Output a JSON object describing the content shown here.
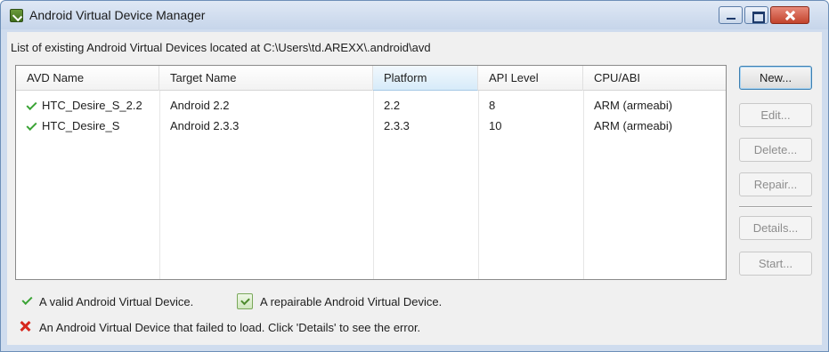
{
  "window": {
    "title": "Android Virtual Device Manager",
    "icon": "android-sdk-icon"
  },
  "list_caption": "List of existing Android Virtual Devices located at C:\\Users\\td.AREXX\\.android\\avd",
  "table": {
    "columns": [
      "AVD Name",
      "Target Name",
      "Platform",
      "API Level",
      "CPU/ABI"
    ],
    "sorted_column": "Platform",
    "rows": [
      {
        "status": "valid",
        "name": "HTC_Desire_S_2.2",
        "target": "Android 2.2",
        "platform": "2.2",
        "api": "8",
        "abi": "ARM (armeabi)"
      },
      {
        "status": "valid",
        "name": "HTC_Desire_S",
        "target": "Android 2.3.3",
        "platform": "2.3.3",
        "api": "10",
        "abi": "ARM (armeabi)"
      }
    ]
  },
  "buttons": {
    "new": "New...",
    "edit": "Edit...",
    "delete": "Delete...",
    "repair": "Repair...",
    "details": "Details...",
    "start": "Start..."
  },
  "legend": {
    "valid": "A valid Android Virtual Device.",
    "repairable": "A repairable Android Virtual Device.",
    "failed": "An Android Virtual Device that failed to load. Click 'Details' to see the error."
  },
  "colors": {
    "valid_check": "#3aa335",
    "error_x": "#d7271c",
    "sorted_header": "#d7ebf9"
  }
}
